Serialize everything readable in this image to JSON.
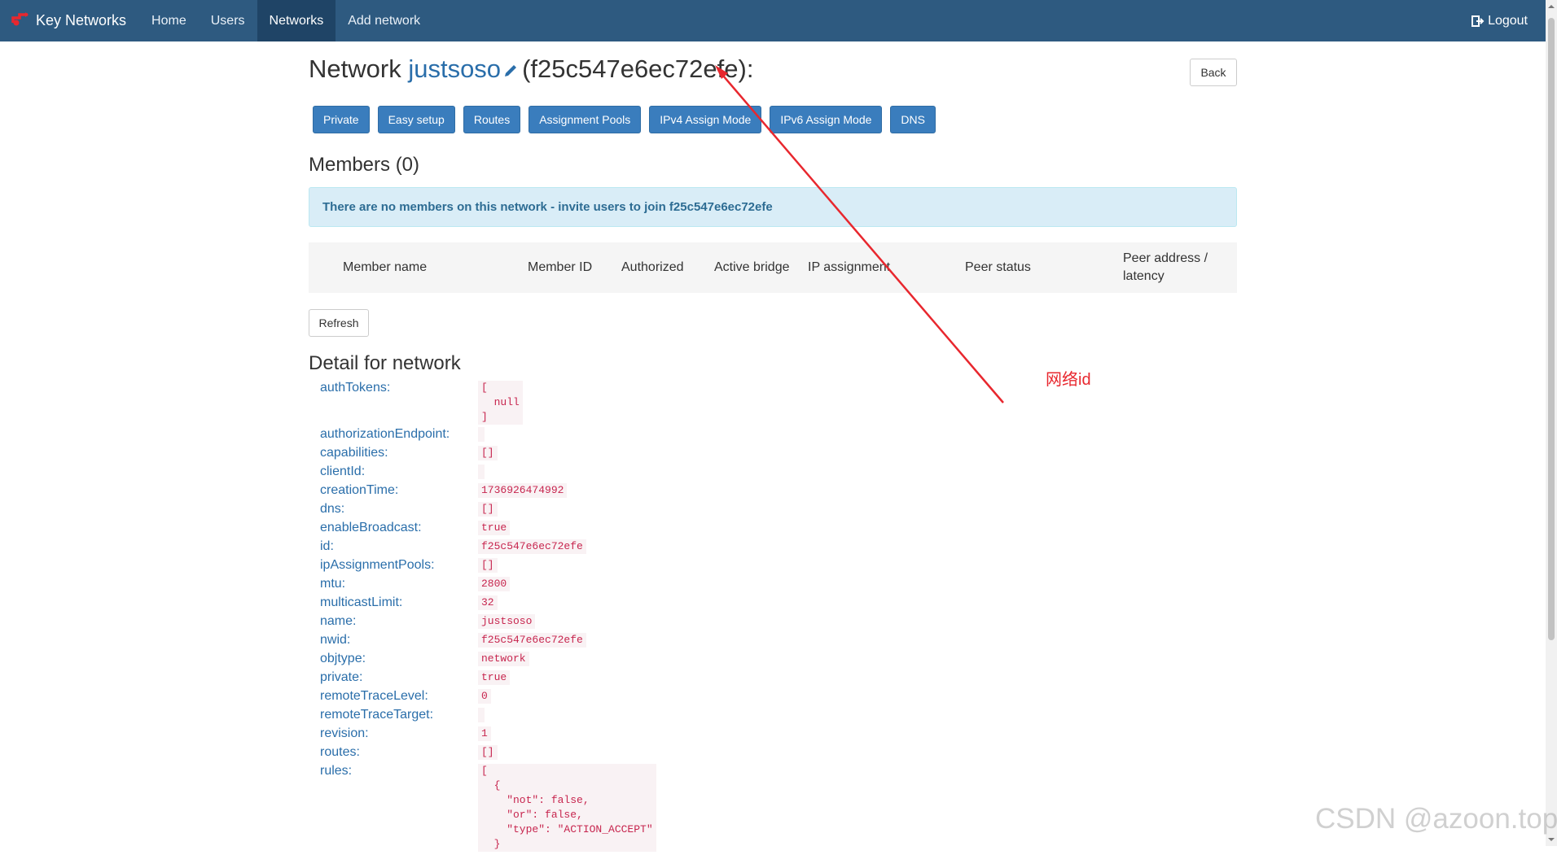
{
  "navbar": {
    "brand": "Key Networks",
    "items": [
      {
        "label": "Home",
        "active": false
      },
      {
        "label": "Users",
        "active": false
      },
      {
        "label": "Networks",
        "active": true
      },
      {
        "label": "Add network",
        "active": false
      }
    ],
    "logout": "Logout",
    "color": "#2e5a80"
  },
  "header": {
    "prefix": "Network",
    "network_name": "justsoso",
    "network_id_display": "(f25c547e6ec72efe):",
    "back_label": "Back"
  },
  "action_buttons": [
    "Private",
    "Easy setup",
    "Routes",
    "Assignment Pools",
    "IPv4 Assign Mode",
    "IPv6 Assign Mode",
    "DNS"
  ],
  "members": {
    "title": "Members (0)",
    "empty_notice": "There are no members on this network - invite users to join f25c547e6ec72efe",
    "columns": [
      "Member name",
      "Member ID",
      "Authorized",
      "Active bridge",
      "IP assignment",
      "Peer status",
      "Peer address /",
      "latency"
    ],
    "refresh_label": "Refresh"
  },
  "detail": {
    "title": "Detail for network",
    "fields": [
      {
        "key": "authTokens:",
        "value": "[\n  null\n]"
      },
      {
        "key": "authorizationEndpoint:",
        "value": ""
      },
      {
        "key": "capabilities:",
        "value": "[]"
      },
      {
        "key": "clientId:",
        "value": ""
      },
      {
        "key": "creationTime:",
        "value": "1736926474992"
      },
      {
        "key": "dns:",
        "value": "[]"
      },
      {
        "key": "enableBroadcast:",
        "value": "true"
      },
      {
        "key": "id:",
        "value": "f25c547e6ec72efe"
      },
      {
        "key": "ipAssignmentPools:",
        "value": "[]"
      },
      {
        "key": "mtu:",
        "value": "2800"
      },
      {
        "key": "multicastLimit:",
        "value": "32"
      },
      {
        "key": "name:",
        "value": "justsoso"
      },
      {
        "key": "nwid:",
        "value": "f25c547e6ec72efe"
      },
      {
        "key": "objtype:",
        "value": "network"
      },
      {
        "key": "private:",
        "value": "true"
      },
      {
        "key": "remoteTraceLevel:",
        "value": "0"
      },
      {
        "key": "remoteTraceTarget:",
        "value": ""
      },
      {
        "key": "revision:",
        "value": "1"
      },
      {
        "key": "routes:",
        "value": "[]"
      },
      {
        "key": "rules:",
        "value": "[\n  {\n    \"not\": false,\n    \"or\": false,\n    \"type\": \"ACTION_ACCEPT\"\n  }"
      }
    ]
  },
  "annotation": {
    "label": "网络id",
    "color": "#e8272e"
  },
  "watermark": "CSDN @azoon.top"
}
